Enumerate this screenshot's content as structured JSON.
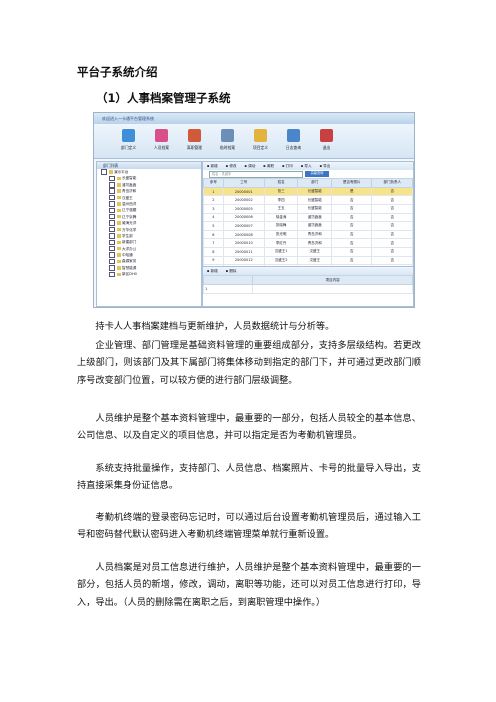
{
  "heading": "平台子系统介绍",
  "subheading": "（1）人事档案管理子系统",
  "app": {
    "title": "欢迎进入一卡通平台管理系统",
    "toolbar": [
      {
        "label": "部门定义",
        "color": "#3f8ed8"
      },
      {
        "label": "人员档案",
        "color": "#d84f8a"
      },
      {
        "label": "离职管理",
        "color": "#d05a3a"
      },
      {
        "label": "临时档案",
        "color": "#6c8fb8"
      },
      {
        "label": "项目定义",
        "color": "#e2b43c"
      },
      {
        "label": "日志查询",
        "color": "#4a86c9"
      },
      {
        "label": "退出",
        "color": "#c94040"
      }
    ],
    "tree_title": "部门列表",
    "tree": [
      {
        "label": "演示平台",
        "level": 0
      },
      {
        "label": "长盛智能",
        "level": 1
      },
      {
        "label": "潍坊鑫鑫",
        "level": 1
      },
      {
        "label": "青岛济和",
        "level": 1
      },
      {
        "label": "汉盛王",
        "level": 1
      },
      {
        "label": "温州西洋",
        "level": 1
      },
      {
        "label": "辽宁强耀",
        "level": 1
      },
      {
        "label": "辽宁京腾",
        "level": 1
      },
      {
        "label": "威海光洋",
        "level": 1
      },
      {
        "label": "万华化学",
        "level": 1
      },
      {
        "label": "学生部",
        "level": 1
      },
      {
        "label": "新建部门",
        "level": 1
      },
      {
        "label": "大洋办公",
        "level": 1
      },
      {
        "label": "中哈通",
        "level": 1
      },
      {
        "label": "森源家务",
        "level": 1
      },
      {
        "label": "智慧能源",
        "level": 1
      },
      {
        "label": "新区DH0",
        "level": 1
      }
    ],
    "grid_toolbar": [
      "新增",
      "修改",
      "调动",
      "离职",
      "打印",
      "导入",
      "导出"
    ],
    "search_placeholder": "姓名：关键字",
    "search_button": "高级查询",
    "columns": [
      "序号",
      "工号",
      "姓名",
      "部门",
      "是否有照片",
      "部门负责人"
    ],
    "rows": [
      [
        "1",
        "20000001",
        "张三",
        "长盛智能",
        "是",
        "否"
      ],
      [
        "2",
        "20000002",
        "李四",
        "长盛智能",
        "否",
        "否"
      ],
      [
        "3",
        "20000005",
        "王五",
        "长盛智能",
        "否",
        "否"
      ],
      [
        "4",
        "20000006",
        "徐金涛",
        "潍坊鑫鑫",
        "否",
        "否"
      ],
      [
        "5",
        "20000007",
        "张晓梅",
        "潍坊鑫鑫",
        "否",
        "否"
      ],
      [
        "6",
        "20000008",
        "张光明",
        "青岛济和",
        "否",
        "否"
      ],
      [
        "7",
        "20000010",
        "李红丹",
        "青岛济和",
        "否",
        "否"
      ],
      [
        "8",
        "20000011",
        "汉盛王1",
        "汉盛王",
        "否",
        "否"
      ],
      [
        "9",
        "20000012",
        "汉盛王2",
        "汉盛王",
        "否",
        "否"
      ],
      [
        "10",
        "20000013",
        "韩工",
        "青岛济和",
        "否",
        "否"
      ],
      [
        "11",
        "20000014",
        "新建人员",
        "青岛济和",
        "否",
        "否"
      ],
      [
        "12",
        "20000015",
        "赵六",
        "长盛智能",
        "否",
        "否"
      ],
      [
        "13",
        "20000021",
        "温州西洋",
        "温州西洋",
        "否",
        "否"
      ]
    ],
    "pager": "1 2 3 4 5 6 7 8 9 10 ▶▶   页数[1/427]  总数[8/12709]  每页[30]条",
    "sub_toolbar": [
      "新增",
      "删除"
    ],
    "sub_columns": [
      "",
      "项目内容"
    ],
    "sub_rows": [
      [
        "1",
        ""
      ]
    ]
  },
  "paragraphs": [
    "持卡人人事档案建档与更新维护，人员数据统计与分析等。",
    "企业管理、部门管理是基础资料管理的重要组成部分，支持多层级结构。若更改上级部门，则该部门及其下属部门将集体移动到指定的部门下，并可通过更改部门顺序号改变部门位置，可以较方便的进行部门层级调整。",
    "人员维护是整个基本资料管理中，最重要的一部分，包括人员较全的基本信息、公司信息、以及自定义的项目信息，并可以指定是否为考勤机管理员。",
    "系统支持批量操作，支持部门、人员信息、档案照片、卡号的批量导入导出，支持直接采集身份证信息。",
    "考勤机终端的登录密码忘记时，可以通过后台设置考勤机管理员后，通过输入工号和密码替代默认密码进入考勤机终端管理菜单就行重新设置。",
    "人员档案是对员工信息进行维护，人员维护是整个基本资料管理中，最重要的一部分，包括人员的新增，修改，调动，离职等功能，还可以对员工信息进行打印，导入，导出。（人员的删除需在离职之后，到离职管理中操作。）"
  ]
}
